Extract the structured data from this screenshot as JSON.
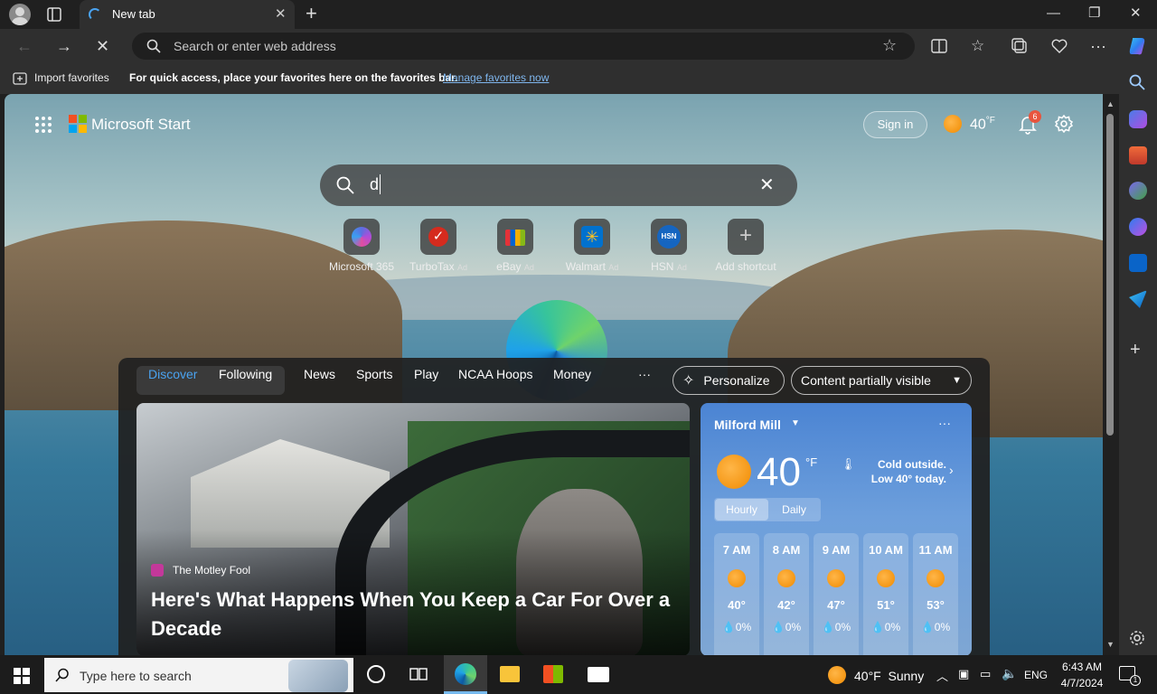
{
  "browser": {
    "tab_title": "New tab",
    "address_placeholder": "Search or enter web address",
    "favorites_bar": {
      "import_label": "Import favorites",
      "message": "For quick access, place your favorites here on the favorites bar.",
      "manage_link": "Manage favorites now"
    }
  },
  "header": {
    "brand": "Microsoft Start",
    "signin_label": "Sign in",
    "temp": "40",
    "temp_unit": "°F",
    "notification_count": "6"
  },
  "search": {
    "query": "d"
  },
  "shortcuts": [
    {
      "label": "Microsoft 365",
      "ad": ""
    },
    {
      "label": "TurboTax",
      "ad": "Ad"
    },
    {
      "label": "eBay",
      "ad": "Ad"
    },
    {
      "label": "Walmart",
      "ad": "Ad"
    },
    {
      "label": "HSN",
      "ad": "Ad"
    },
    {
      "label": "Add shortcut",
      "ad": ""
    }
  ],
  "shortcut_icons": {
    "hsn_text": "HSN"
  },
  "feed": {
    "tabs": [
      "Discover",
      "Following",
      "News",
      "Sports",
      "Play",
      "NCAA Hoops",
      "Money"
    ],
    "more_label": "···",
    "personalize_label": "Personalize",
    "visibility_label": "Content partially visible"
  },
  "story": {
    "source": "The Motley Fool",
    "headline": "Here's What Happens When You Keep a Car For Over a Decade"
  },
  "weather": {
    "location": "Milford Mill",
    "temp": "40",
    "unit": "°F",
    "summary": "Cold outside. Low 40° today.",
    "tabs": [
      "Hourly",
      "Daily"
    ],
    "hourly": [
      {
        "time": "7 AM",
        "temp": "40°",
        "precip": "0%"
      },
      {
        "time": "8 AM",
        "temp": "42°",
        "precip": "0%"
      },
      {
        "time": "9 AM",
        "temp": "47°",
        "precip": "0%"
      },
      {
        "time": "10 AM",
        "temp": "51°",
        "precip": "0%"
      },
      {
        "time": "11 AM",
        "temp": "53°",
        "precip": "0%"
      }
    ]
  },
  "taskbar": {
    "search_placeholder": "Type here to search",
    "weather": "40°F  Sunny",
    "lang": "ENG",
    "time": "6:43 AM",
    "date": "4/7/2024",
    "notif_count": "1"
  },
  "colors": {
    "accent": "#0078d4",
    "sun": "#f59a1b",
    "weather_bg": "#4b84d3"
  }
}
